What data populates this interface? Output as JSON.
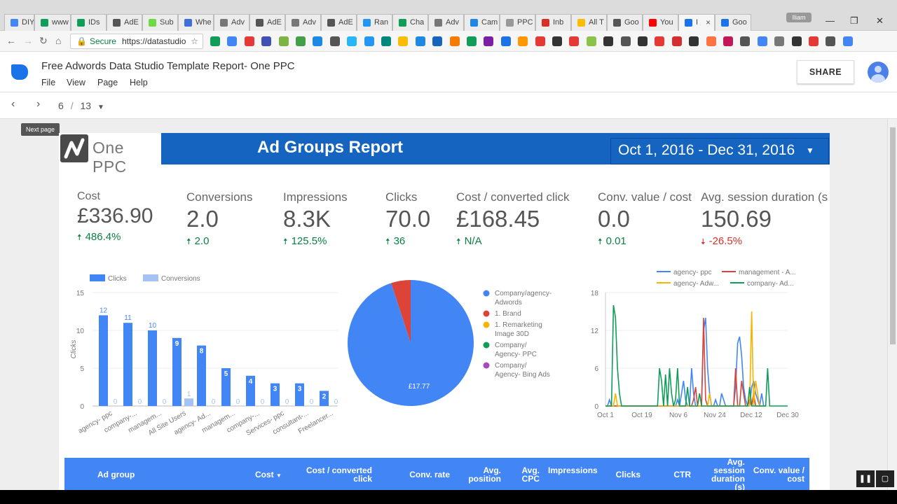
{
  "browser": {
    "tabs": [
      {
        "label": "DIY",
        "color": "#4285f4"
      },
      {
        "label": "www",
        "color": "#0f9d58"
      },
      {
        "label": "IDs",
        "color": "#0f9d58"
      },
      {
        "label": "AdE",
        "color": "#555555"
      },
      {
        "label": "Sub",
        "color": "#6fda44"
      },
      {
        "label": "Whe",
        "color": "#3f6fd8"
      },
      {
        "label": "Adv",
        "color": "#777777"
      },
      {
        "label": "AdE",
        "color": "#555555"
      },
      {
        "label": "Adv",
        "color": "#777777"
      },
      {
        "label": "AdE",
        "color": "#555555"
      },
      {
        "label": "Ran",
        "color": "#2196f3"
      },
      {
        "label": "Cha",
        "color": "#0f9d58"
      },
      {
        "label": "Adv",
        "color": "#777777"
      },
      {
        "label": "Cam",
        "color": "#1e88e5"
      },
      {
        "label": "PPC",
        "color": "#999999"
      },
      {
        "label": "Inb",
        "color": "#d93025"
      },
      {
        "label": "All T",
        "color": "#fbbc04"
      },
      {
        "label": "Goo",
        "color": "#555555"
      },
      {
        "label": "You",
        "color": "#ff0000"
      },
      {
        "label": "I",
        "color": "#1a73e8"
      },
      {
        "label": "Goo",
        "color": "#1a73e8"
      }
    ],
    "profile": "Iliam",
    "secure_label": "Secure",
    "url": "https://datastudio"
  },
  "app": {
    "title": "Free Adwords Data Studio Template Report-   One PPC",
    "menus": [
      "File",
      "View",
      "Page",
      "Help"
    ],
    "share_label": "SHARE",
    "page_current": "6",
    "page_sep": "/",
    "page_total": "13",
    "tooltip": "Next page"
  },
  "report": {
    "logo_text": "One PPC",
    "title": "Ad Groups Report",
    "date_range": "Oct 1, 2016 - Dec 31, 2016",
    "kpis": [
      {
        "label": "Cost",
        "value": "£336.90",
        "delta": "486.4%",
        "dir": "up"
      },
      {
        "label": "Conversions",
        "value": "2.0",
        "delta": "2.0",
        "dir": "up"
      },
      {
        "label": "Impressions",
        "value": "8.3K",
        "delta": "125.5%",
        "dir": "up"
      },
      {
        "label": "Clicks",
        "value": "70.0",
        "delta": "36",
        "dir": "up"
      },
      {
        "label": "Cost / converted click",
        "value": "£168.45",
        "delta": "N/A",
        "dir": "up"
      },
      {
        "label": "Conv. value / cost",
        "value": "0.0",
        "delta": "0.01",
        "dir": "up"
      },
      {
        "label": "Avg. session duration (s",
        "value": "150.69",
        "delta": "-26.5%",
        "dir": "down"
      }
    ],
    "table_headers": [
      "Ad group",
      "Cost",
      "Cost / converted click",
      "Conv. rate",
      "Avg. position",
      "Avg. CPC",
      "Impressions",
      "Clicks",
      "CTR",
      "Avg. session duration (s)",
      "Conv. value / cost"
    ]
  },
  "chart_data": [
    {
      "type": "bar",
      "categories": [
        "agency- ppc",
        "company-...",
        "managem...",
        "All Site Users",
        "agency- Ad...",
        "managem...",
        "company-...",
        "Services- ppc",
        "consultant-...",
        "Freelancer..."
      ],
      "series": [
        {
          "name": "Clicks",
          "values": [
            12,
            11,
            10,
            9,
            8,
            5,
            4,
            3,
            3,
            2
          ],
          "color": "#4285f4"
        },
        {
          "name": "Conversions",
          "values": [
            0,
            0,
            0,
            1,
            0,
            0,
            0,
            0,
            0,
            0
          ],
          "color": "#a4c2f4"
        }
      ],
      "ylabel": "Clicks",
      "ylim": [
        0,
        15
      ],
      "yticks": [
        0,
        5,
        10,
        15
      ],
      "legend": "top-left"
    },
    {
      "type": "pie",
      "slices": [
        {
          "label": "Company/agency-Adwords",
          "value": 95,
          "color": "#4285f4"
        },
        {
          "label": "1. Brand",
          "value": 5,
          "color": "#db4437"
        },
        {
          "label": "1. Remarketing Image 30D",
          "value": 0,
          "color": "#f4b400"
        },
        {
          "label": "Company/ Agency- PPC",
          "value": 0,
          "color": "#0f9d58"
        },
        {
          "label": "Company/ Agency- Bing Ads",
          "value": 0,
          "color": "#ab47bc"
        }
      ],
      "slice_label": "£17.77",
      "legend": "right"
    },
    {
      "type": "line",
      "x_ticks": [
        "Oct 1",
        "Oct 19",
        "Nov 6",
        "Nov 24",
        "Dec 12",
        "Dec 30"
      ],
      "ylim": [
        0,
        18
      ],
      "yticks": [
        0,
        6,
        12,
        18
      ],
      "legend": "top",
      "series": [
        {
          "name": "agency- ppc",
          "color": "#4285f4",
          "values": [
            0,
            0,
            1,
            0,
            0,
            0,
            0,
            0,
            0,
            0,
            0,
            0,
            0,
            0,
            0,
            0,
            0,
            0,
            0,
            0,
            0,
            0,
            0,
            0,
            0,
            0,
            0,
            0,
            0,
            0,
            0,
            0,
            0,
            0,
            0,
            0,
            1,
            0,
            2,
            4,
            1,
            0,
            0,
            6,
            2,
            0,
            0,
            0,
            0,
            12,
            14,
            6,
            2,
            0,
            0,
            1,
            0,
            0,
            2,
            1,
            0,
            0,
            0,
            0,
            0,
            3,
            10,
            11,
            8,
            3,
            1,
            0,
            0,
            3,
            4,
            2,
            1,
            0,
            2,
            0,
            0,
            0,
            0,
            0,
            0,
            0,
            0,
            0,
            0,
            0,
            0,
            0
          ]
        },
        {
          "name": "management - A...",
          "color": "#db4437",
          "values": [
            0,
            0,
            0,
            0,
            0,
            0,
            0,
            0,
            0,
            0,
            0,
            0,
            0,
            0,
            0,
            0,
            0,
            0,
            0,
            0,
            0,
            0,
            0,
            0,
            0,
            0,
            0,
            0,
            0,
            0,
            0,
            0,
            0,
            0,
            0,
            0,
            0,
            0,
            0,
            0,
            0,
            0,
            0,
            0,
            1,
            3,
            0,
            0,
            0,
            14,
            1,
            0,
            0,
            0,
            0,
            0,
            0,
            0,
            0,
            0,
            0,
            0,
            0,
            0,
            0,
            6,
            0,
            0,
            4,
            2,
            0,
            0,
            1,
            0,
            2,
            0,
            0,
            0,
            0,
            0,
            0,
            0,
            0,
            0,
            0,
            0,
            0,
            0,
            0,
            0,
            0,
            0
          ]
        },
        {
          "name": "agency- Adw...",
          "color": "#f4b400",
          "values": [
            0,
            0,
            0,
            0,
            0,
            2,
            0,
            0,
            0,
            0,
            0,
            0,
            0,
            0,
            0,
            0,
            0,
            0,
            0,
            0,
            0,
            0,
            0,
            0,
            0,
            0,
            0,
            0,
            0,
            0,
            0,
            0,
            0,
            0,
            0,
            0,
            0,
            0,
            0,
            0,
            0,
            0,
            0,
            0,
            0,
            0,
            0,
            0,
            0,
            0,
            0,
            0,
            2,
            0,
            0,
            0,
            0,
            0,
            0,
            0,
            0,
            0,
            0,
            0,
            0,
            0,
            0,
            0,
            0,
            0,
            0,
            0,
            0,
            15,
            0,
            4,
            2,
            0,
            0,
            0,
            0,
            0,
            0,
            0,
            0,
            0,
            0,
            0,
            0,
            0,
            0,
            0
          ]
        },
        {
          "name": "company- Ad...",
          "color": "#0f9d58",
          "values": [
            0,
            0,
            0,
            0,
            16,
            14,
            6,
            2,
            0,
            0,
            0,
            0,
            0,
            0,
            0,
            0,
            0,
            0,
            0,
            0,
            0,
            0,
            0,
            0,
            0,
            0,
            0,
            6,
            4,
            0,
            5,
            0,
            6,
            2,
            0,
            1,
            6,
            0,
            0,
            0,
            0,
            3,
            0,
            0,
            0,
            0,
            0,
            2,
            0,
            0,
            0,
            0,
            0,
            0,
            0,
            0,
            0,
            0,
            0,
            0,
            0,
            0,
            0,
            0,
            0,
            0,
            0,
            0,
            0,
            0,
            0,
            0,
            3,
            0,
            0,
            0,
            0,
            0,
            0,
            0,
            0,
            6,
            0,
            0,
            0,
            0,
            0,
            0,
            0,
            0,
            0,
            0
          ]
        }
      ]
    }
  ]
}
